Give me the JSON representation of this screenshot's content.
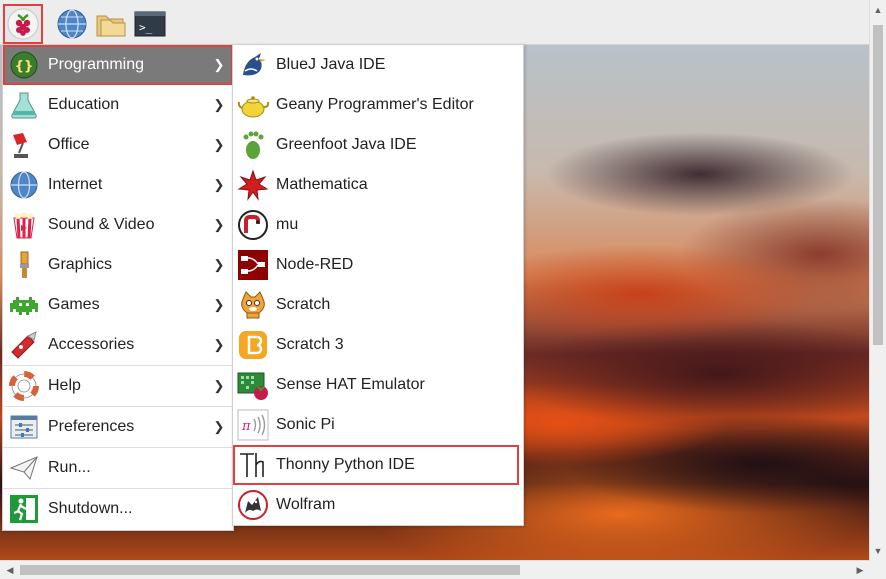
{
  "taskbar": {
    "icons": [
      "raspberry-pi-menu-icon",
      "web-browser-icon",
      "file-manager-icon",
      "terminal-icon"
    ]
  },
  "main_menu": {
    "items": [
      {
        "label": "Programming",
        "icon": "programming-icon",
        "submenu": true,
        "active": true
      },
      {
        "label": "Education",
        "icon": "education-flask-icon",
        "submenu": true
      },
      {
        "label": "Office",
        "icon": "office-lamp-icon",
        "submenu": true
      },
      {
        "label": "Internet",
        "icon": "globe-icon",
        "submenu": true
      },
      {
        "label": "Sound & Video",
        "icon": "popcorn-icon",
        "submenu": true
      },
      {
        "label": "Graphics",
        "icon": "paintbrush-icon",
        "submenu": true
      },
      {
        "label": "Games",
        "icon": "space-invader-icon",
        "submenu": true
      },
      {
        "label": "Accessories",
        "icon": "swiss-knife-icon",
        "submenu": true
      },
      {
        "label": "Help",
        "icon": "lifebuoy-icon",
        "submenu": true
      },
      {
        "label": "Preferences",
        "icon": "preferences-sliders-icon",
        "submenu": true
      },
      {
        "label": "Run...",
        "icon": "paper-plane-icon",
        "submenu": false
      },
      {
        "label": "Shutdown...",
        "icon": "exit-running-man-icon",
        "submenu": false
      }
    ]
  },
  "programming_submenu": {
    "items": [
      {
        "label": "BlueJ Java IDE",
        "icon": "bluej-bird-icon"
      },
      {
        "label": "Geany Programmer's Editor",
        "icon": "geany-teapot-icon"
      },
      {
        "label": "Greenfoot Java IDE",
        "icon": "greenfoot-footprint-icon"
      },
      {
        "label": "Mathematica",
        "icon": "mathematica-star-icon"
      },
      {
        "label": "mu",
        "icon": "mu-editor-icon"
      },
      {
        "label": "Node-RED",
        "icon": "node-red-icon"
      },
      {
        "label": "Scratch",
        "icon": "scratch-cat-icon"
      },
      {
        "label": "Scratch 3",
        "icon": "scratch3-icon"
      },
      {
        "label": "Sense HAT Emulator",
        "icon": "sense-hat-icon"
      },
      {
        "label": "Sonic Pi",
        "icon": "sonic-pi-icon"
      },
      {
        "label": "Thonny Python IDE",
        "icon": "thonny-icon",
        "highlighted": true
      },
      {
        "label": "Wolfram",
        "icon": "wolfram-wolf-icon"
      }
    ]
  },
  "colors": {
    "highlight_outline": "#e04040",
    "active_bg": "#7a7a7a"
  }
}
